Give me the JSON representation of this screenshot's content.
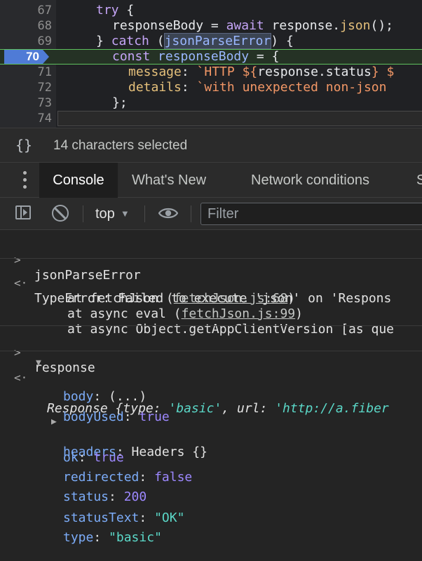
{
  "editor": {
    "lines": [
      {
        "n": "67",
        "code": "try {"
      },
      {
        "n": "68",
        "code": "responseBody = await response.json();"
      },
      {
        "n": "69",
        "code": "} catch (jsonParseError) {"
      },
      {
        "n": "70",
        "code": "const responseBody = {"
      },
      {
        "n": "71",
        "code": "message: `HTTP ${response.status} $"
      },
      {
        "n": "72",
        "code": "details: `with unexpected non-json"
      },
      {
        "n": "73",
        "code": "};"
      },
      {
        "n": "74",
        "code": ""
      }
    ]
  },
  "status": {
    "selection": "14 characters selected",
    "icon": "braces-icon"
  },
  "tabs": {
    "console": "Console",
    "whats_new": "What's New",
    "network": "Network conditions",
    "more": "S"
  },
  "toolbar": {
    "context": "top",
    "filter_placeholder": "Filter"
  },
  "console": {
    "cmd1": "jsonParseError",
    "err_head": "TypeError: Failed to execute 'json' on 'Respons",
    "stack": [
      {
        "pre": "at fetchJson (",
        "link": "fetchJson.js:68",
        "post": ")"
      },
      {
        "pre": "at async eval (",
        "link": "fetchJson.js:99",
        "post": ")"
      },
      {
        "pre": "at async Object.getAppClientVersion [as que",
        "link": "",
        "post": ""
      }
    ],
    "cmd2": "response",
    "obj_head": {
      "class": "Response",
      "k1": "type",
      "v1": "'basic'",
      "k2": "url",
      "v2": "'http://a.fiber"
    },
    "props": [
      {
        "key": "body",
        "value": "(...)",
        "kind": "plain",
        "expand": false
      },
      {
        "key": "bodyUsed",
        "value": "true",
        "kind": "bool",
        "expand": false
      },
      {
        "key": "headers",
        "value": "Headers {}",
        "kind": "plain",
        "expand": true
      },
      {
        "key": "ok",
        "value": "true",
        "kind": "bool",
        "expand": false
      },
      {
        "key": "redirected",
        "value": "false",
        "kind": "bool",
        "expand": false
      },
      {
        "key": "status",
        "value": "200",
        "kind": "num",
        "expand": false
      },
      {
        "key": "statusText",
        "value": "\"OK\"",
        "kind": "str",
        "expand": false
      },
      {
        "key": "type",
        "value": "\"basic\"",
        "kind": "str",
        "expand": false
      }
    ]
  }
}
